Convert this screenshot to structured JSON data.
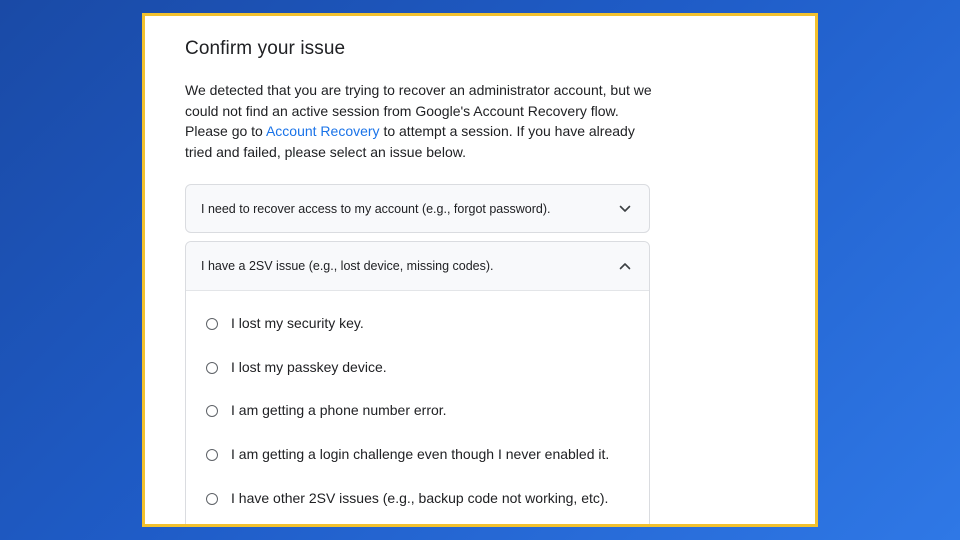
{
  "page": {
    "title": "Confirm your issue",
    "description_before_link": "We detected that you are trying to recover an administrator account, but we could not find an active session from Google's Account Recovery flow. Please go to ",
    "link_text": "Account Recovery",
    "description_after_link": " to attempt a session. If you have already tried and failed, please select an issue below."
  },
  "accordion": [
    {
      "label": "I need to recover access to my account (e.g., forgot password).",
      "expanded": false,
      "icon": "chevron-down-icon"
    },
    {
      "label": "I have a 2SV issue (e.g., lost device, missing codes).",
      "expanded": true,
      "icon": "chevron-up-icon",
      "options": [
        {
          "label": "I lost my security key."
        },
        {
          "label": "I lost my passkey device."
        },
        {
          "label": "I am getting a phone number error."
        },
        {
          "label": "I am getting a login challenge even though I never enabled it."
        },
        {
          "label": "I have other 2SV issues (e.g., backup code not working, etc)."
        }
      ]
    }
  ],
  "colors": {
    "frame_border": "#f2c12e",
    "link": "#1a73e8",
    "text": "#202124",
    "background_start": "#1a4aa6",
    "background_end": "#2f78e6"
  }
}
